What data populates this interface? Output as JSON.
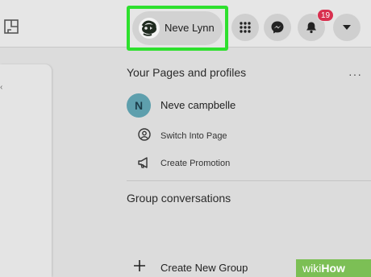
{
  "header": {
    "profile": {
      "name": "Neve Lynn",
      "avatar": "chameleon-avatar"
    },
    "notifications": {
      "count": "19"
    },
    "icons": [
      "layout-icon",
      "grid-menu-icon",
      "messenger-icon",
      "bell-icon",
      "caret-down-icon"
    ],
    "highlight_color": "#2ee02e"
  },
  "menu": {
    "pages_section_title": "Your Pages and profiles",
    "more_label": "···",
    "page": {
      "initial": "N",
      "name": "Neve campbelle",
      "avatar_color": "#5e9fad"
    },
    "actions": [
      {
        "label": "Switch Into Page",
        "icon": "switch-profile-icon"
      },
      {
        "label": "Create Promotion",
        "icon": "megaphone-icon"
      }
    ],
    "group_section_title": "Group conversations",
    "create_group_label": "Create New Group"
  },
  "watermark": {
    "prefix": "wiki",
    "suffix": "How"
  }
}
